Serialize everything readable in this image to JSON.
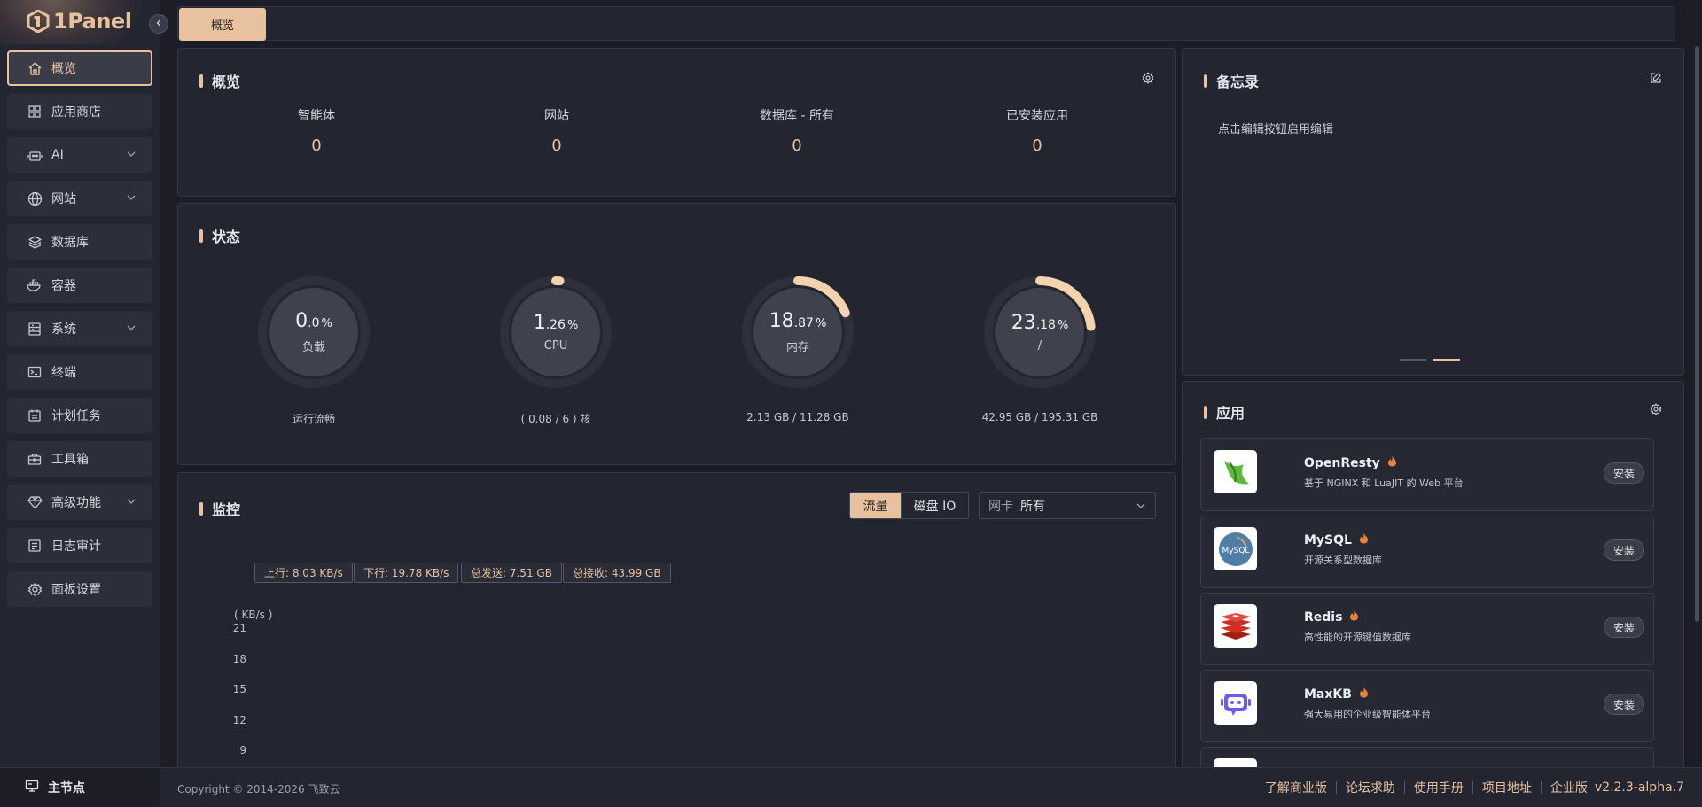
{
  "brand": {
    "name": "1Panel"
  },
  "sidebar": {
    "items": [
      {
        "label": "概览",
        "icon": "home-icon",
        "active": true,
        "expandable": false
      },
      {
        "label": "应用商店",
        "icon": "grid-icon",
        "active": false,
        "expandable": false
      },
      {
        "label": "AI",
        "icon": "robot-icon",
        "active": false,
        "expandable": true
      },
      {
        "label": "网站",
        "icon": "globe-icon",
        "active": false,
        "expandable": true
      },
      {
        "label": "数据库",
        "icon": "layers-icon",
        "active": false,
        "expandable": false
      },
      {
        "label": "容器",
        "icon": "docker-icon",
        "active": false,
        "expandable": false
      },
      {
        "label": "系统",
        "icon": "server-icon",
        "active": false,
        "expandable": true
      },
      {
        "label": "终端",
        "icon": "terminal-icon",
        "active": false,
        "expandable": false
      },
      {
        "label": "计划任务",
        "icon": "calendar-icon",
        "active": false,
        "expandable": false
      },
      {
        "label": "工具箱",
        "icon": "toolbox-icon",
        "active": false,
        "expandable": false
      },
      {
        "label": "高级功能",
        "icon": "diamond-icon",
        "active": false,
        "expandable": true
      },
      {
        "label": "日志审计",
        "icon": "log-icon",
        "active": false,
        "expandable": false
      },
      {
        "label": "面板设置",
        "icon": "settings-icon",
        "active": false,
        "expandable": false
      }
    ],
    "node": {
      "label": "主节点",
      "icon": "node-icon"
    }
  },
  "tabbar": {
    "active_tab": "概览"
  },
  "overview": {
    "title": "概览",
    "items": [
      {
        "label": "智能体",
        "value": "0"
      },
      {
        "label": "网站",
        "value": "0"
      },
      {
        "label": "数据库 - 所有",
        "value": "0"
      },
      {
        "label": "已安装应用",
        "value": "0"
      }
    ]
  },
  "status": {
    "title": "状态",
    "gauges": [
      {
        "int": "0",
        "dec": ".0",
        "unit": "%",
        "percent": 0.0,
        "name": "负载",
        "foot": "运行流畅"
      },
      {
        "int": "1",
        "dec": ".26",
        "unit": "%",
        "percent": 1.26,
        "name": "CPU",
        "foot": "( 0.08 / 6 ) 核"
      },
      {
        "int": "18",
        "dec": ".87",
        "unit": "%",
        "percent": 18.87,
        "name": "内存",
        "foot": "2.13 GB / 11.28 GB"
      },
      {
        "int": "23",
        "dec": ".18",
        "unit": "%",
        "percent": 23.18,
        "name": "/",
        "foot": "42.95 GB / 195.31 GB"
      }
    ]
  },
  "monitor": {
    "title": "监控",
    "seg_on": "流量",
    "seg_off": "磁盘 IO",
    "select_prefix": "网卡",
    "select_value": "所有",
    "chips": [
      "上行: 8.03 KB/s",
      "下行: 19.78 KB/s",
      "总发送: 7.51 GB",
      "总接收: 43.99 GB"
    ],
    "unit": "( KB/s )",
    "ticks": [
      "21",
      "18",
      "15",
      "12",
      "9"
    ]
  },
  "memo": {
    "title": "备忘录",
    "hint": "点击编辑按钮启用编辑"
  },
  "apps": {
    "title": "应用",
    "install_label": "安装",
    "items": [
      {
        "name": "OpenResty",
        "desc": "基于 NGINX 和 LuaJIT 的 Web 平台",
        "logo": "openresty-logo"
      },
      {
        "name": "MySQL",
        "desc": "开源关系型数据库",
        "logo": "mysql-logo"
      },
      {
        "name": "Redis",
        "desc": "高性能的开源键值数据库",
        "logo": "redis-logo"
      },
      {
        "name": "MaxKB",
        "desc": "强大易用的企业级智能体平台",
        "logo": "maxkb-logo"
      }
    ]
  },
  "footer": {
    "copyright": "Copyright © 2014-2026 飞致云",
    "links": [
      "了解商业版",
      "论坛求助",
      "使用手册",
      "项目地址",
      "企业版"
    ],
    "version": "v2.2.3-alpha.7"
  },
  "colors": {
    "accent": "#e8c29f",
    "bg": "#1c1d26",
    "panel": "#232530"
  }
}
